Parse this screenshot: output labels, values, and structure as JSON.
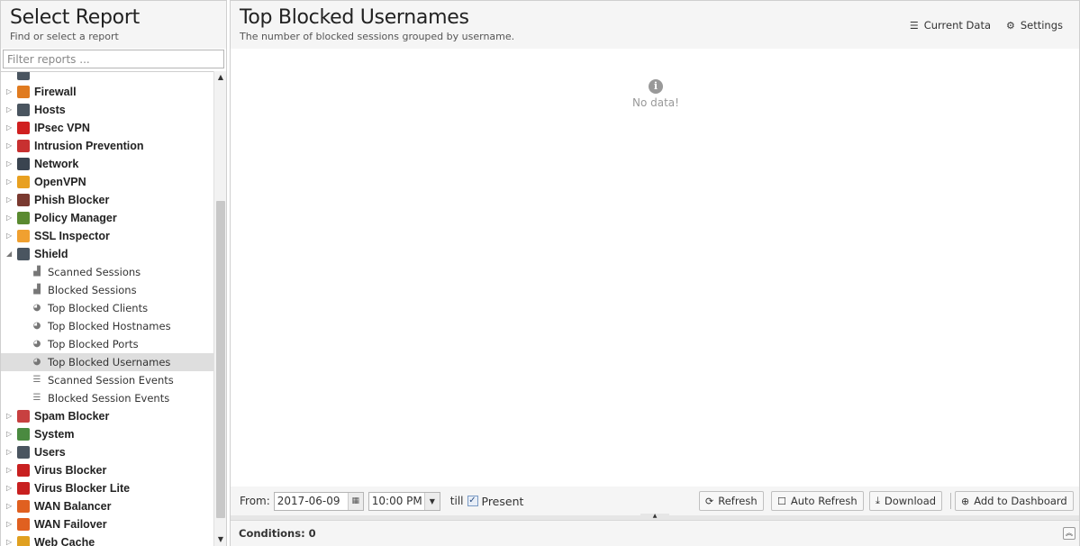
{
  "sidebar": {
    "title": "Select Report",
    "subtitle": "Find or select a report",
    "filter_placeholder": "Filter reports ...",
    "categories": [
      {
        "label": "Firewall",
        "icon": "firewall-icon",
        "color": "#e07b20"
      },
      {
        "label": "Hosts",
        "icon": "hosts-icon",
        "color": "#4a5560"
      },
      {
        "label": "IPsec VPN",
        "icon": "ipsec-vpn-icon",
        "color": "#d02020"
      },
      {
        "label": "Intrusion Prevention",
        "icon": "intrusion-prevention-icon",
        "color": "#c83030"
      },
      {
        "label": "Network",
        "icon": "network-icon",
        "color": "#3a4450"
      },
      {
        "label": "OpenVPN",
        "icon": "openvpn-icon",
        "color": "#e8a020"
      },
      {
        "label": "Phish Blocker",
        "icon": "phish-blocker-icon",
        "color": "#7a3a30"
      },
      {
        "label": "Policy Manager",
        "icon": "policy-manager-icon",
        "color": "#5a8a30"
      },
      {
        "label": "SSL Inspector",
        "icon": "ssl-inspector-icon",
        "color": "#f0a030"
      },
      {
        "label": "Shield",
        "icon": "shield-icon",
        "color": "#4a5560"
      }
    ],
    "shield_reports": [
      {
        "label": "Scanned Sessions",
        "icon": "bar-chart-icon"
      },
      {
        "label": "Blocked Sessions",
        "icon": "bar-chart-icon"
      },
      {
        "label": "Top Blocked Clients",
        "icon": "pie-chart-icon"
      },
      {
        "label": "Top Blocked Hostnames",
        "icon": "pie-chart-icon"
      },
      {
        "label": "Top Blocked Ports",
        "icon": "pie-chart-icon"
      },
      {
        "label": "Top Blocked Usernames",
        "icon": "pie-chart-icon"
      },
      {
        "label": "Scanned Session Events",
        "icon": "list-icon"
      },
      {
        "label": "Blocked Session Events",
        "icon": "list-icon"
      }
    ],
    "categories_after": [
      {
        "label": "Spam Blocker",
        "icon": "spam-blocker-icon",
        "color": "#c84040"
      },
      {
        "label": "System",
        "icon": "system-icon",
        "color": "#4a8a40"
      },
      {
        "label": "Users",
        "icon": "users-icon",
        "color": "#4a5560"
      },
      {
        "label": "Virus Blocker",
        "icon": "virus-blocker-icon",
        "color": "#c82020"
      },
      {
        "label": "Virus Blocker Lite",
        "icon": "virus-blocker-lite-icon",
        "color": "#c82020"
      },
      {
        "label": "WAN Balancer",
        "icon": "wan-balancer-icon",
        "color": "#e06020"
      },
      {
        "label": "WAN Failover",
        "icon": "wan-failover-icon",
        "color": "#e06020"
      },
      {
        "label": "Web Cache",
        "icon": "web-cache-icon",
        "color": "#e0a020"
      }
    ]
  },
  "report": {
    "title": "Top Blocked Usernames",
    "subtitle": "The number of blocked sessions grouped by username.",
    "current_data_label": "Current Data",
    "settings_label": "Settings",
    "no_data": "No data!"
  },
  "toolbar": {
    "from_label": "From:",
    "date": "2017-06-09",
    "time": "10:00 PM",
    "till_label": "till",
    "present_label": "Present",
    "present_checked": true,
    "refresh_label": "Refresh",
    "auto_refresh_label": "Auto Refresh",
    "download_label": "Download",
    "add_dashboard_label": "Add to Dashboard"
  },
  "conditions": {
    "label": "Conditions: 0"
  }
}
